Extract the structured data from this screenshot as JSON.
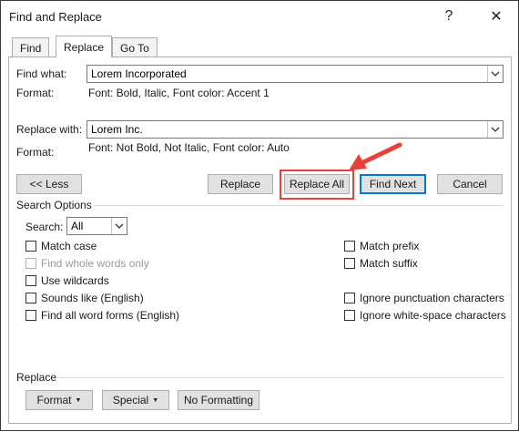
{
  "window": {
    "title": "Find and Replace",
    "help_label": "?",
    "close_label": "✕"
  },
  "tabs": [
    {
      "label": "Find",
      "active": false
    },
    {
      "label": "Replace",
      "active": true
    },
    {
      "label": "Go To",
      "active": false
    }
  ],
  "find": {
    "label": "Find what:",
    "value": "Lorem Incorporated",
    "format_label": "Format:",
    "format_value": "Font: Bold, Italic, Font color: Accent 1"
  },
  "replace": {
    "label": "Replace with:",
    "value": "Lorem Inc.",
    "format_label": "Format:",
    "format_value": "Font: Not Bold, Not Italic, Font color: Auto"
  },
  "buttons": {
    "less": "<< Less",
    "replace": "Replace",
    "replace_all": "Replace All",
    "find_next": "Find Next",
    "cancel": "Cancel"
  },
  "search_options": {
    "title": "Search Options",
    "search_label": "Search:",
    "search_value": "All",
    "left": [
      {
        "label": "Match case",
        "checked": false,
        "disabled": false
      },
      {
        "label": "Find whole words only",
        "checked": false,
        "disabled": true
      },
      {
        "label": "Use wildcards",
        "checked": false,
        "disabled": false
      },
      {
        "label": "Sounds like (English)",
        "checked": false,
        "disabled": false
      },
      {
        "label": "Find all word forms (English)",
        "checked": false,
        "disabled": false
      }
    ],
    "right": [
      {
        "label": "Match prefix",
        "checked": false
      },
      {
        "label": "Match suffix",
        "checked": false
      },
      {
        "label": "Ignore punctuation characters",
        "checked": false
      },
      {
        "label": "Ignore white-space characters",
        "checked": false
      }
    ]
  },
  "replace_section": {
    "title": "Replace",
    "format_btn": "Format",
    "special_btn": "Special",
    "no_formatting_btn": "No Formatting"
  },
  "colors": {
    "accent": "#0078d7",
    "annotation": "#e8403a"
  }
}
